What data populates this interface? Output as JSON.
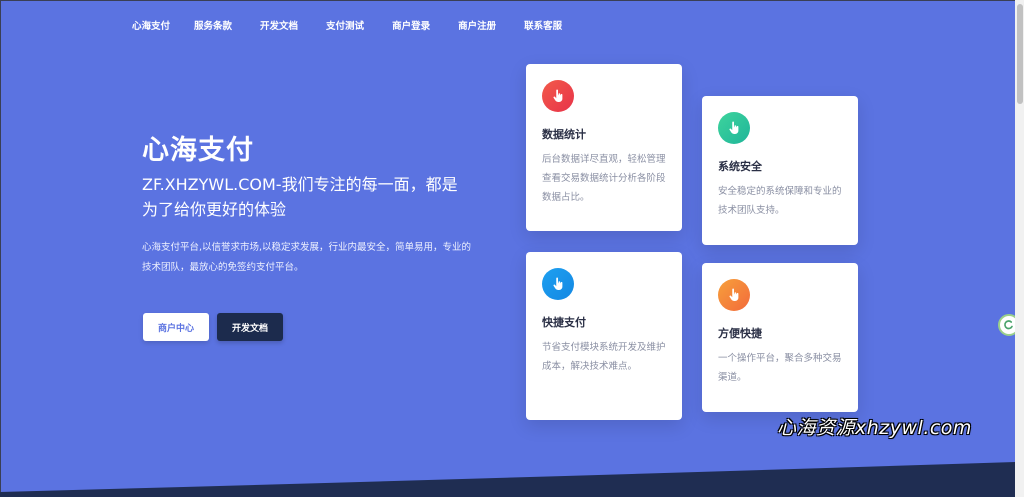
{
  "nav": {
    "items": [
      {
        "label": "心海支付"
      },
      {
        "label": "服务条款"
      },
      {
        "label": "开发文档"
      },
      {
        "label": "支付测试"
      },
      {
        "label": "商户登录"
      },
      {
        "label": "商户注册"
      },
      {
        "label": "联系客服"
      }
    ]
  },
  "hero": {
    "title": "心海支付",
    "subtitle": "ZF.XHZYWL.COM-我们专注的每一面，都是为了给你更好的体验",
    "description": "心海支付平台,以信誉求市场,以稳定求发展，行业内最安全，简单易用，专业的技术团队，最放心的免签约支付平台。",
    "buttons": {
      "merchant_center": "商户中心",
      "dev_docs": "开发文档"
    }
  },
  "features": [
    {
      "title": "数据统计",
      "desc": "后台数据详尽直观，轻松管理查看交易数据统计分析各阶段数据占比。",
      "icon": "hand-pointer-icon",
      "color": "#e83349"
    },
    {
      "title": "系统安全",
      "desc": "安全稳定的系统保障和专业的技术团队支持。",
      "icon": "hand-pointer-icon",
      "color": "#1fb59a"
    },
    {
      "title": "快捷支付",
      "desc": "节省支付模块系统开发及维护成本，解决技术难点。",
      "icon": "hand-pointer-icon",
      "color": "#1488e3"
    },
    {
      "title": "方便快捷",
      "desc": "一个操作平台，聚合多种交易渠道。",
      "icon": "hand-pointer-icon",
      "color": "#f26a3b"
    }
  ],
  "watermark": "心海资源xhzywl.com",
  "colors": {
    "background": "#5b73e1",
    "dark_button": "#1c2b4d",
    "wave": "#1f2d52"
  }
}
